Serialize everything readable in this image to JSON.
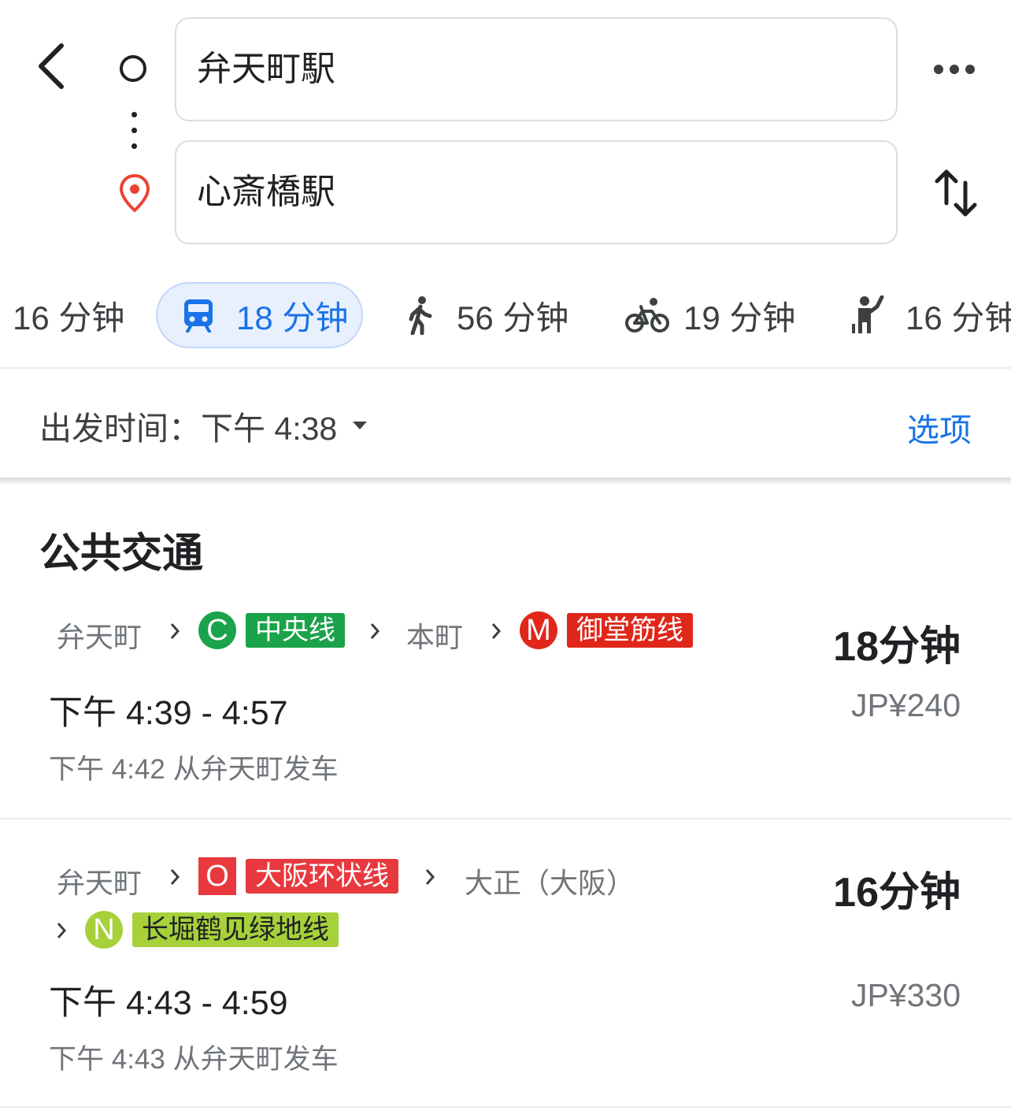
{
  "header": {
    "origin": "弁天町駅",
    "destination": "心斎橋駅"
  },
  "modes": [
    {
      "icon": "car-icon",
      "label": "16 分钟"
    },
    {
      "icon": "train-icon",
      "label": "18 分钟",
      "selected": true
    },
    {
      "icon": "walk-icon",
      "label": "56 分钟"
    },
    {
      "icon": "bike-icon",
      "label": "19 分钟"
    },
    {
      "icon": "ride-hail-icon",
      "label": "16 分钟"
    }
  ],
  "depart": {
    "label": "出发时间：",
    "value": "下午 4:38",
    "options": "选项"
  },
  "section_title": "公共交通",
  "colors": {
    "accent": "#1a73e8",
    "chuo_line": "#1aa34a",
    "midosuji_line": "#e0271a",
    "loop_line": "#e8393f",
    "nagahori_line": "#a6d13a"
  },
  "routes": [
    {
      "steps": [
        "弁天町",
        "本町"
      ],
      "lines": [
        {
          "letter": "C",
          "name": "中央线"
        },
        {
          "letter": "M",
          "name": "御堂筋线"
        }
      ],
      "times": "下午 4:39 - 4:57",
      "departs": "下午 4:42 从弁天町发车",
      "duration": "18分钟",
      "fare": "JP¥240"
    },
    {
      "steps": [
        "弁天町",
        "大正（大阪）"
      ],
      "lines": [
        {
          "letter": "O",
          "name": "大阪环状线"
        },
        {
          "letter": "N",
          "name": "长堀鹤见绿地线"
        }
      ],
      "times": "下午 4:43 - 4:59",
      "departs": "下午 4:43 从弁天町发车",
      "duration": "16分钟",
      "fare": "JP¥330"
    }
  ]
}
